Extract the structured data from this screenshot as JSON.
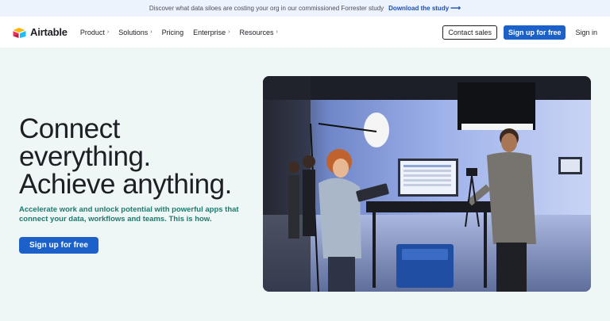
{
  "banner": {
    "text": "Discover what data siloes are costing your org in our commissioned Forrester study",
    "link_label": "Download the study",
    "link_icon": "arrow-right-icon"
  },
  "nav": {
    "brand": "Airtable",
    "items": [
      {
        "label": "Product",
        "has_chevron": true
      },
      {
        "label": "Solutions",
        "has_chevron": true
      },
      {
        "label": "Pricing",
        "has_chevron": false
      },
      {
        "label": "Enterprise",
        "has_chevron": true
      },
      {
        "label": "Resources",
        "has_chevron": true
      }
    ],
    "contact_label": "Contact sales",
    "signup_label": "Sign up for free",
    "signin_label": "Sign in"
  },
  "hero": {
    "title_lines": [
      "Connect",
      "everything.",
      "Achieve anything."
    ],
    "subtitle": "Accelerate work and unlock potential with powerful apps that connect your data, workflows and teams. This is how.",
    "cta_label": "Sign up for free"
  },
  "colors": {
    "accent": "#1b61c9",
    "subtitle": "#1d7a6e",
    "background": "#eef7f6",
    "banner_bg": "#edf3fd"
  }
}
